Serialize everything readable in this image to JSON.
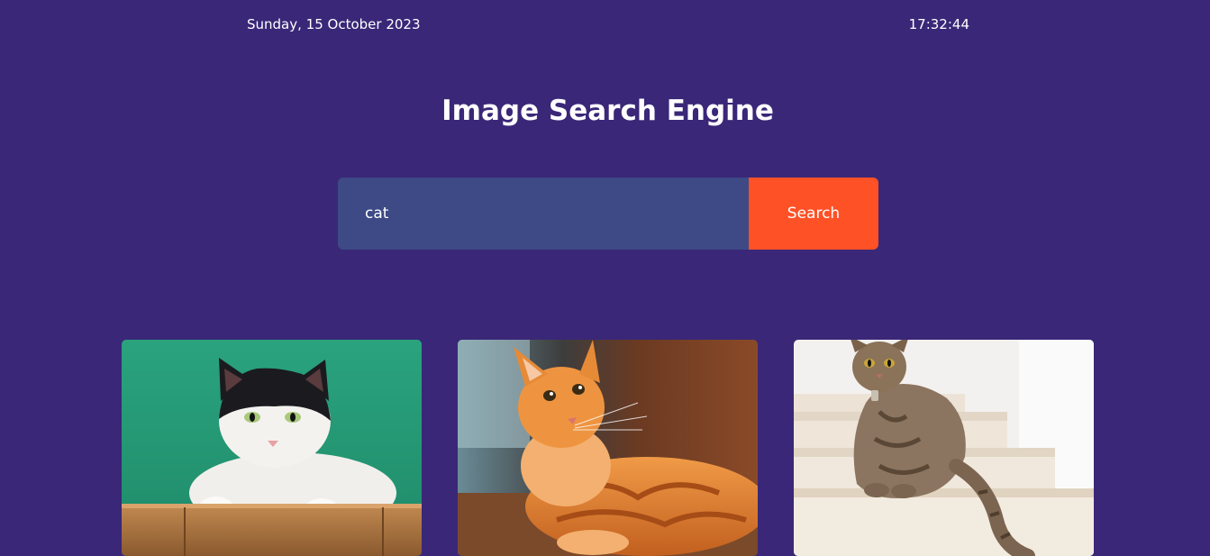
{
  "header": {
    "date": "Sunday, 15 October 2023",
    "time": "17:32:44"
  },
  "page": {
    "title": "Image Search Engine"
  },
  "search": {
    "value": "cat",
    "button_label": "Search"
  },
  "results": [
    {
      "icon": "cat-photo-black-white-on-green"
    },
    {
      "icon": "cat-photo-orange-tabby-lying"
    },
    {
      "icon": "cat-photo-tabby-on-stairs"
    }
  ],
  "colors": {
    "background": "#3a2778",
    "input_background": "#3d4a85",
    "button_background": "#ff5126",
    "text": "#ffffff"
  }
}
